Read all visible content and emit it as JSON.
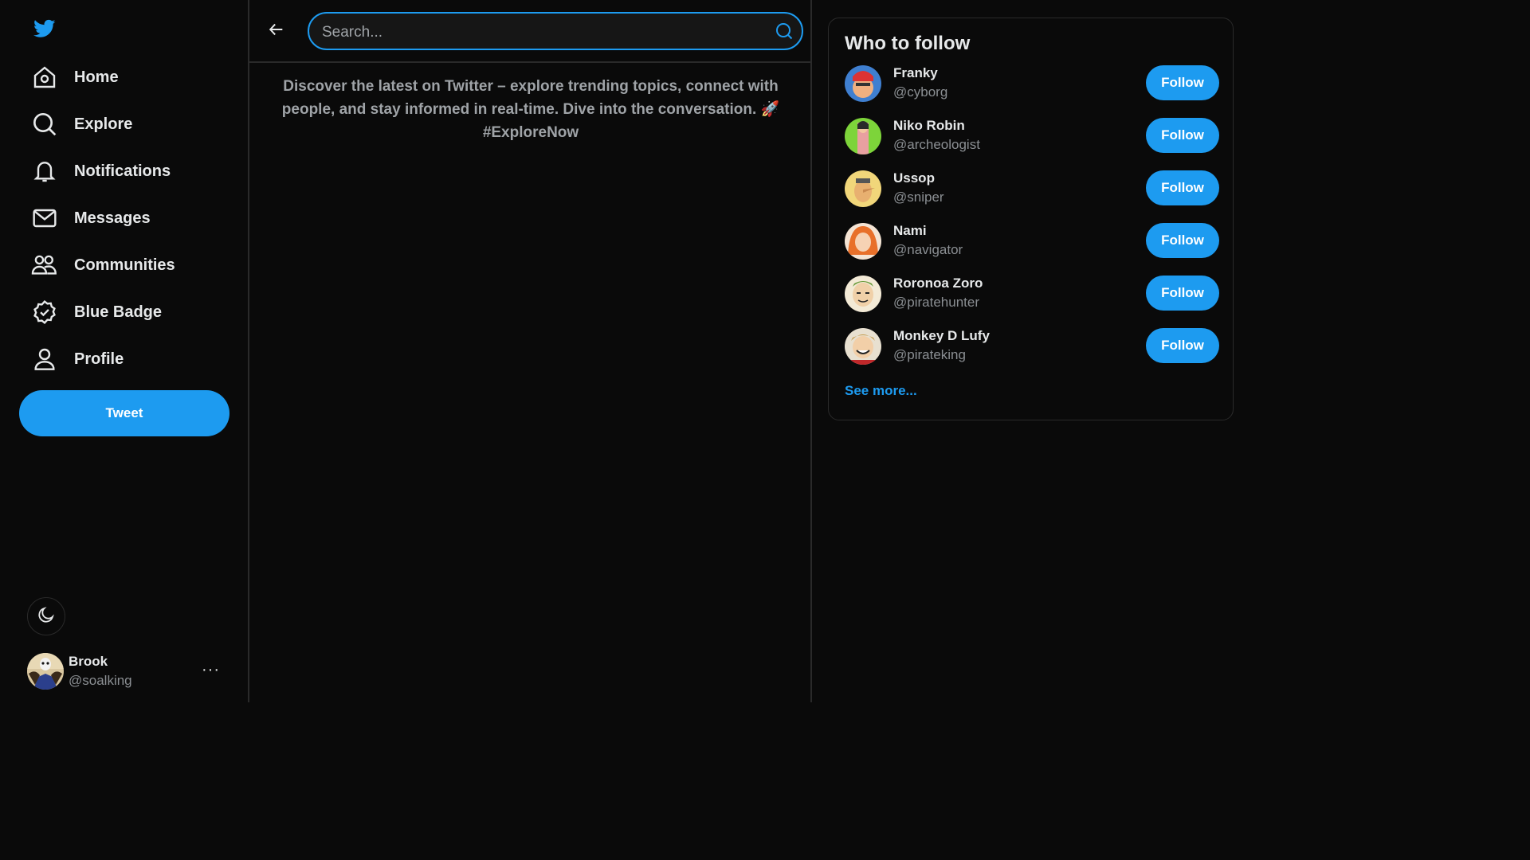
{
  "brand": {
    "logo_icon": "twitter-bird-icon",
    "accent": "#1d9bf0"
  },
  "sidebar": {
    "items": [
      {
        "label": "Home",
        "icon": "home-icon"
      },
      {
        "label": "Explore",
        "icon": "search-icon"
      },
      {
        "label": "Notifications",
        "icon": "bell-icon"
      },
      {
        "label": "Messages",
        "icon": "mail-icon"
      },
      {
        "label": "Communities",
        "icon": "people-icon"
      },
      {
        "label": "Blue Badge",
        "icon": "verified-badge-icon"
      },
      {
        "label": "Profile",
        "icon": "user-icon"
      }
    ],
    "tweet_label": "Tweet",
    "theme_icon": "moon-icon",
    "account": {
      "name": "Brook",
      "handle": "@soalking",
      "more": "···"
    }
  },
  "main": {
    "search": {
      "placeholder": "Search...",
      "value": ""
    },
    "intro": "Discover the latest on Twitter – explore trending topics, connect with people, and stay informed in real-time. Dive into the conversation. 🚀 #ExploreNow"
  },
  "who_to_follow": {
    "title": "Who to follow",
    "follow_label": "Follow",
    "users": [
      {
        "name": "Franky",
        "handle": "@cyborg"
      },
      {
        "name": "Niko Robin",
        "handle": "@archeologist"
      },
      {
        "name": "Ussop",
        "handle": "@sniper"
      },
      {
        "name": "Nami",
        "handle": "@navigator"
      },
      {
        "name": "Roronoa Zoro",
        "handle": "@piratehunter"
      },
      {
        "name": "Monkey D Lufy",
        "handle": "@pirateking"
      }
    ],
    "see_more": "See more..."
  }
}
